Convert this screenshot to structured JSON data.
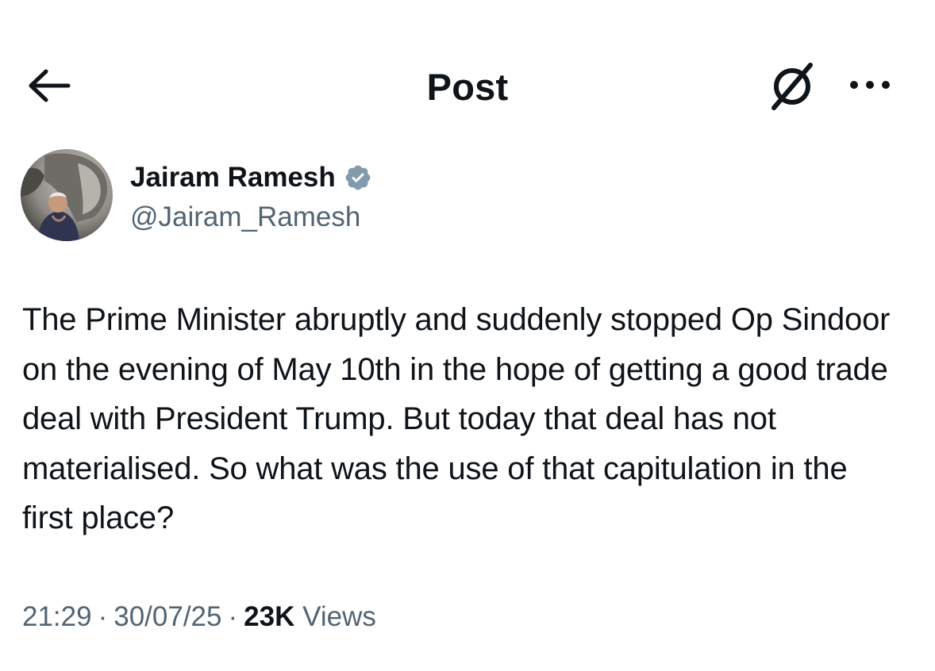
{
  "header": {
    "title": "Post",
    "back_icon": "arrow-left-icon",
    "grok_icon": "grok-icon",
    "more_icon": "more-horizontal-icon"
  },
  "author": {
    "display_name": "Jairam Ramesh",
    "handle": "@Jairam_Ramesh",
    "verified_icon": "verified-badge-icon",
    "verified_color": "#829aab"
  },
  "tweet": {
    "text": "The Prime Minister abruptly and suddenly stopped Op Sindoor on the evening of May 10th in the hope of getting a good trade deal with President Trump. But today that deal has not materialised. So what was the use of that capitulation in the first place?"
  },
  "meta": {
    "time": "21:29",
    "separator": "·",
    "date": "30/07/25",
    "views_count": "23K",
    "views_label": "Views"
  },
  "colors": {
    "text_primary": "#0f1419",
    "text_secondary": "#536471",
    "background": "#ffffff"
  }
}
